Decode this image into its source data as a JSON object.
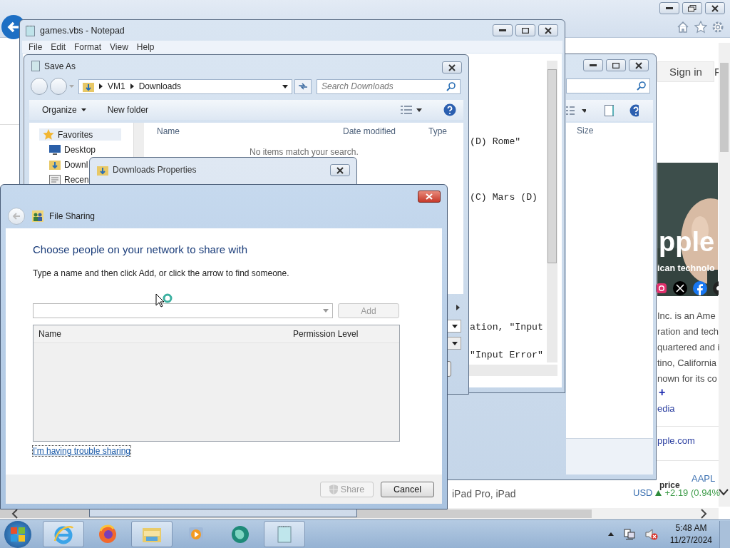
{
  "browser": {
    "sign_in": "Sign in",
    "next_button_fragment": "F",
    "article": {
      "title": "pple",
      "subtitle": "ican technolo",
      "summary_lines": [
        "Inc. is an Ame",
        "ration and tech",
        "quartered and i",
        "tino, California",
        "nown for its co"
      ],
      "expand": "+",
      "source": "edia",
      "website": "pple.com",
      "stock_label": "price",
      "stock_symbol": "AAPL",
      "stock_currency": "USD",
      "stock_change": "+2.19 (0.94%"
    },
    "side_text": "iPad Pro, iPad"
  },
  "explorer": {
    "columns": [
      "Size"
    ]
  },
  "notepad": {
    "title": "games.vbs - Notepad",
    "menu": [
      "File",
      "Edit",
      "Format",
      "View",
      "Help"
    ],
    "lines": [
      "(D) Rome\"",
      "(C) Mars (D)",
      "ation, \"Input",
      "\"Input Error\""
    ]
  },
  "save_as": {
    "title": "Save As",
    "path": [
      "VM1",
      "Downloads"
    ],
    "search": {
      "placeholder": "Search Downloads"
    },
    "toolbar": [
      "Organize",
      "New folder"
    ],
    "nav": [
      {
        "kind": "favorites",
        "label": "Favorites",
        "selected": true
      },
      {
        "kind": "desktop",
        "label": "Desktop",
        "selected": false
      },
      {
        "kind": "downloads",
        "label": "Downl",
        "selected": false
      },
      {
        "kind": "recent",
        "label": "Recen",
        "selected": false
      }
    ],
    "columns": [
      "Name",
      "Date modified",
      "Type"
    ],
    "empty_message": "No items match your search."
  },
  "properties": {
    "title": "Downloads Properties"
  },
  "file_sharing": {
    "title": "File Sharing",
    "heading": "Choose people on your network to share with",
    "instruction": "Type a name and then click Add, or click the arrow to find someone.",
    "add": {
      "label": "Add",
      "disabled": true
    },
    "columns": [
      "Name",
      "Permission Level"
    ],
    "link": "I'm having trouble sharing",
    "share": {
      "label": "Share",
      "disabled": true
    },
    "cancel": "Cancel"
  },
  "taskbar": {
    "apps": [
      {
        "kind": "ie",
        "active": true
      },
      {
        "kind": "firefox",
        "active": false
      },
      {
        "kind": "explorer",
        "active": true
      },
      {
        "kind": "media",
        "active": false
      },
      {
        "kind": "globe",
        "active": false
      },
      {
        "kind": "notepad",
        "active": true
      }
    ],
    "time": "5:48 AM",
    "date": "11/27/2024"
  }
}
